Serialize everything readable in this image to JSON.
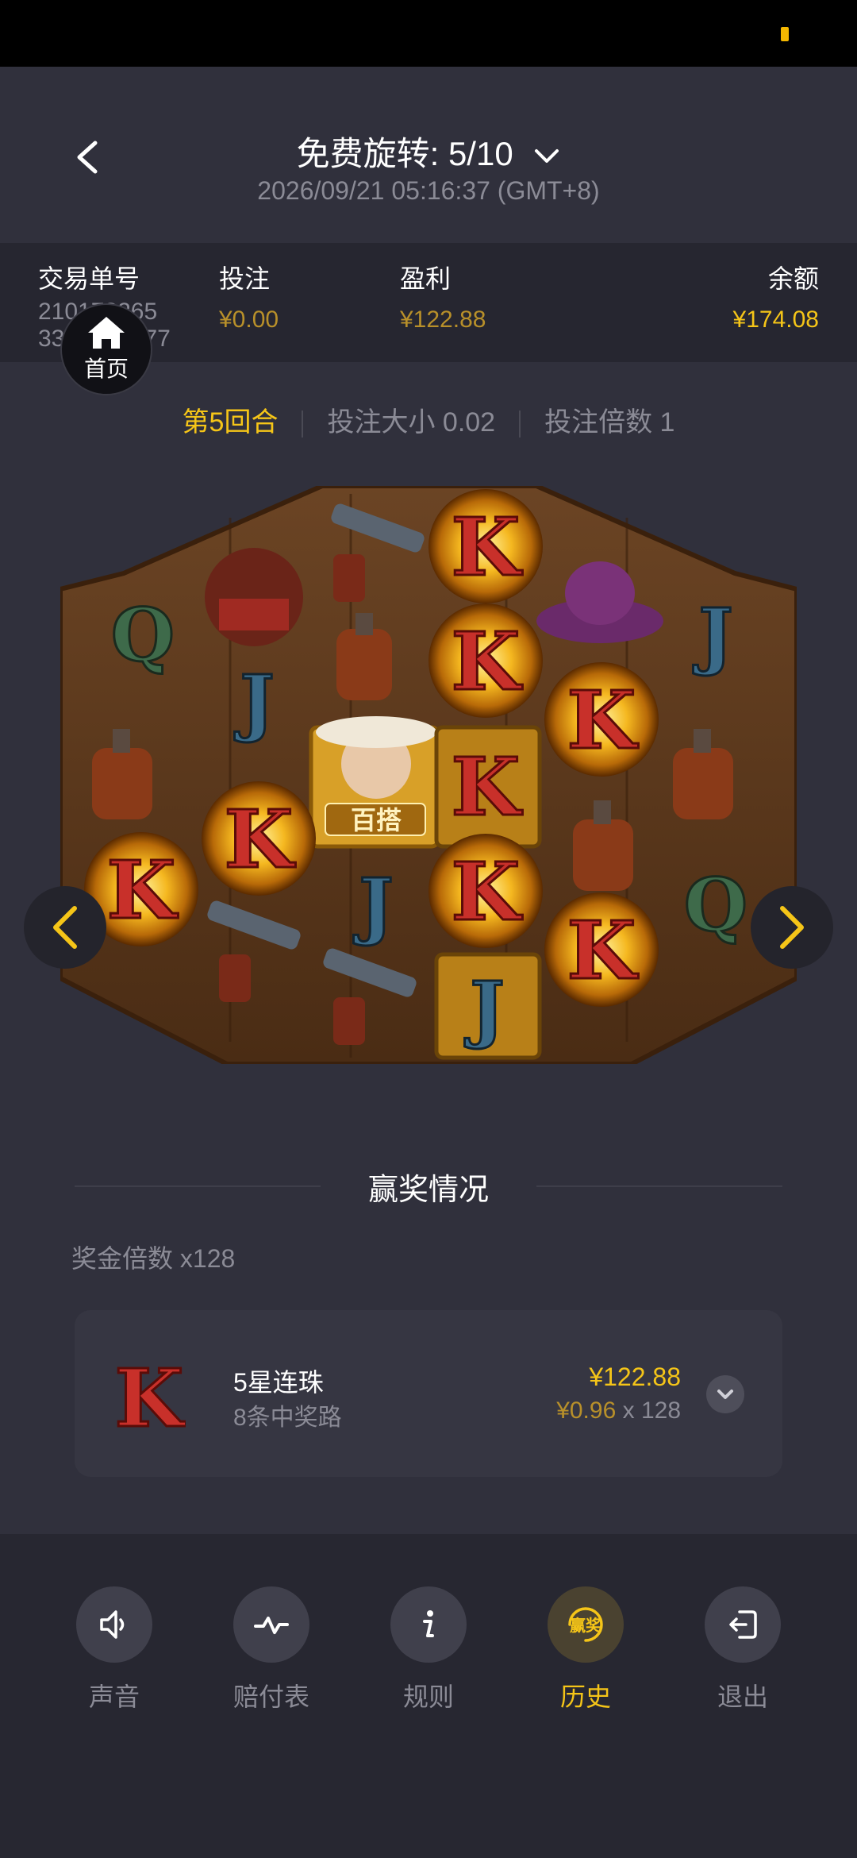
{
  "header": {
    "title": "免费旋转: 5/10",
    "datetime": "2026/09/21 05:16:37 (GMT+8)"
  },
  "info": {
    "transaction_label": "交易单号",
    "transaction_line1": "210178265",
    "transaction_line2": "3358213577",
    "bet_label": "投注",
    "bet_value": "¥0.00",
    "profit_label": "盈利",
    "profit_value": "¥122.88",
    "balance_label": "余额",
    "balance_value": "¥174.08"
  },
  "home": {
    "label": "首页"
  },
  "round": {
    "round_label": "第5回合",
    "bet_size": "投注大小 0.02",
    "bet_multiplier": "投注倍数 1"
  },
  "win": {
    "section_title": "赢奖情况",
    "multiplier": "奖金倍数 x128",
    "line_name": "5星连珠",
    "line_ways": "8条中奖路",
    "line_amount": "¥122.88",
    "line_unit": "¥0.96",
    "line_times": "x 128",
    "symbol": "K"
  },
  "wild_label": "百搭",
  "bottom_nav": {
    "sound": "声音",
    "paytable": "赔付表",
    "rules": "规则",
    "history": "历史",
    "exit": "退出",
    "history_icon_text": "赢奖"
  },
  "colors": {
    "accent": "#f5c518",
    "muted_gold": "#b8902a",
    "background": "#30303c"
  }
}
